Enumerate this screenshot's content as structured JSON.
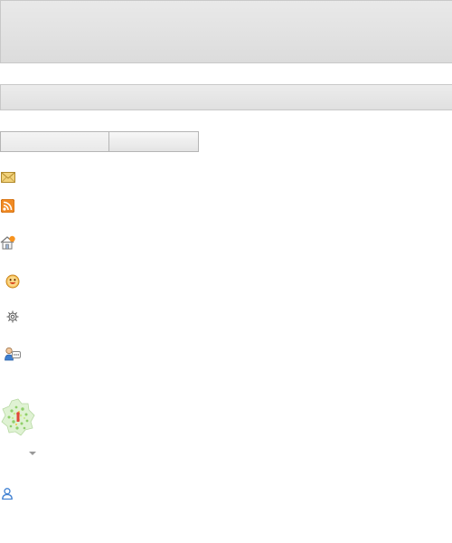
{
  "header": {},
  "subheader": {},
  "search": {
    "value": "",
    "placeholder": ""
  },
  "icons": [
    {
      "name": "mail-icon"
    },
    {
      "name": "rss-feed-icon"
    },
    {
      "name": "home-notification-icon"
    },
    {
      "name": "smiley-icon"
    },
    {
      "name": "settings-gear-icon"
    },
    {
      "name": "user-chat-icon"
    },
    {
      "name": "profile-avatar-globe-icon"
    },
    {
      "name": "user-account-icon"
    }
  ],
  "colors": {
    "bar_background": "#e3e3e3",
    "bar_border": "#c8c8c8",
    "rss_orange": "#f08a24",
    "notification_orange": "#f7931e",
    "user_blue": "#3d7fd1",
    "envelope_yellow": "#f2d27a"
  }
}
